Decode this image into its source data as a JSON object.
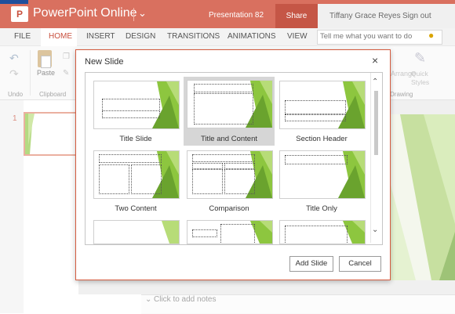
{
  "app": {
    "title": "PowerPoint Online",
    "logo_letter": "P",
    "document": "Presentation 82",
    "share": "Share",
    "user": "Tiffany Grace Reyes",
    "sign_out": "Sign out"
  },
  "tabs": [
    "FILE",
    "HOME",
    "INSERT",
    "DESIGN",
    "TRANSITIONS",
    "ANIMATIONS",
    "VIEW"
  ],
  "active_tab": "HOME",
  "tell_me": {
    "placeholder": "Tell me what you want to do"
  },
  "ribbon": {
    "undo_group": "Undo",
    "clipboard_group": "Clipboard",
    "paste": "Paste",
    "arrange": "Arrange",
    "quick_styles": "Quick Styles",
    "drawing_group": "Drawing"
  },
  "thumbnails": {
    "slide_number": "1"
  },
  "notes": {
    "placeholder": "Click to add notes"
  },
  "dialog": {
    "title": "New Slide",
    "close": "×",
    "layouts": [
      "Title Slide",
      "Title and Content",
      "Section Header",
      "Two Content",
      "Comparison",
      "Title Only",
      "",
      "",
      ""
    ],
    "selected_layout": "Title and Content",
    "add_button": "Add Slide",
    "cancel_button": "Cancel"
  },
  "colors": {
    "brand": "#d9705f",
    "accent_green": "#8dc63f",
    "dark_green": "#6aa32e",
    "selection": "#d6d6d6"
  }
}
